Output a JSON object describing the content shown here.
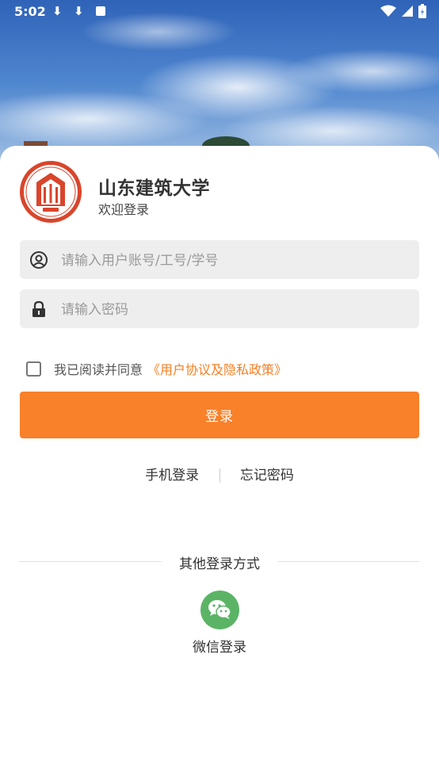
{
  "status_bar": {
    "time": "5:02",
    "download1": "⬇",
    "download2": "⬇"
  },
  "header": {
    "university_name": "山东建筑大学",
    "welcome": "欢迎登录"
  },
  "login_form": {
    "account_placeholder": "请输入用户账号/工号/学号",
    "password_placeholder": "请输入密码",
    "agree_text": "我已阅读并同意",
    "agreement_link": "《用户协议及隐私政策》",
    "login_button": "登录"
  },
  "links": {
    "phone_login": "手机登录",
    "forgot_password": "忘记密码"
  },
  "other_login": {
    "title": "其他登录方式",
    "wechat_label": "微信登录"
  },
  "colors": {
    "accent": "#f8812a",
    "link": "#f47f24",
    "wechat": "#5bb466",
    "logo": "#d9452b"
  }
}
